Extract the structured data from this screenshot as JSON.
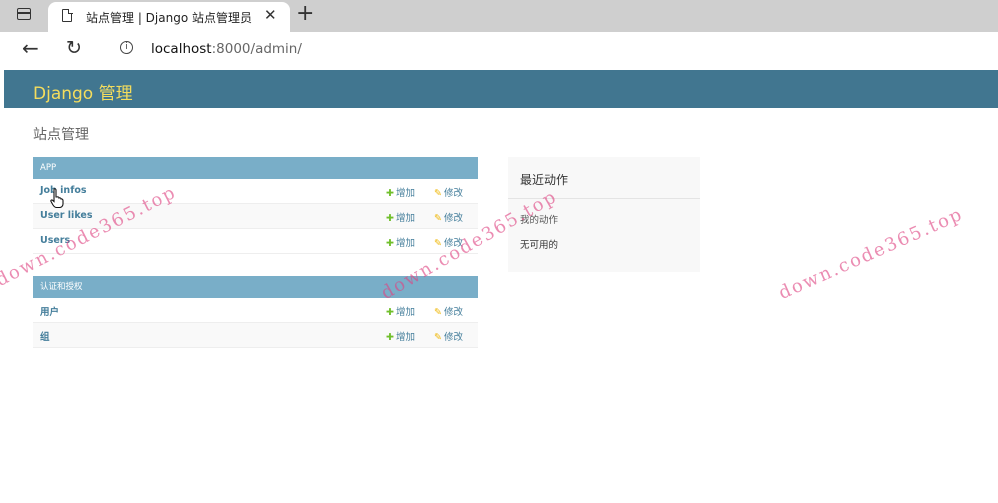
{
  "browser": {
    "tab_title": "站点管理 | Django 站点管理员",
    "tab_close": "✕",
    "new_tab": "+",
    "url_host": "localhost",
    "url_rest": ":8000/admin/",
    "back": "←",
    "reload": "↻",
    "info": "i"
  },
  "header": {
    "brand": "Django 管理"
  },
  "page_title": "站点管理",
  "modules": [
    {
      "caption": "APP",
      "models": [
        {
          "name": "Job infos",
          "add": "增加",
          "change": "修改"
        },
        {
          "name": "User likes",
          "add": "增加",
          "change": "修改"
        },
        {
          "name": "Users",
          "add": "增加",
          "change": "修改"
        }
      ]
    },
    {
      "caption": "认证和授权",
      "models": [
        {
          "name": "用户",
          "add": "增加",
          "change": "修改"
        },
        {
          "name": "组",
          "add": "增加",
          "change": "修改"
        }
      ]
    }
  ],
  "recent_actions": {
    "title": "最近动作",
    "mine": "我的动作",
    "none": "无可用的"
  },
  "icons": {
    "add": "✚",
    "change": "✎"
  },
  "watermark": "down.code365.top",
  "colors": {
    "header_bg": "#417690",
    "brand": "#f5dd5d",
    "caption_bg": "#79aec8",
    "link": "#447e9b",
    "add_icon": "#70bf2b",
    "edit_icon": "#efb80b"
  }
}
